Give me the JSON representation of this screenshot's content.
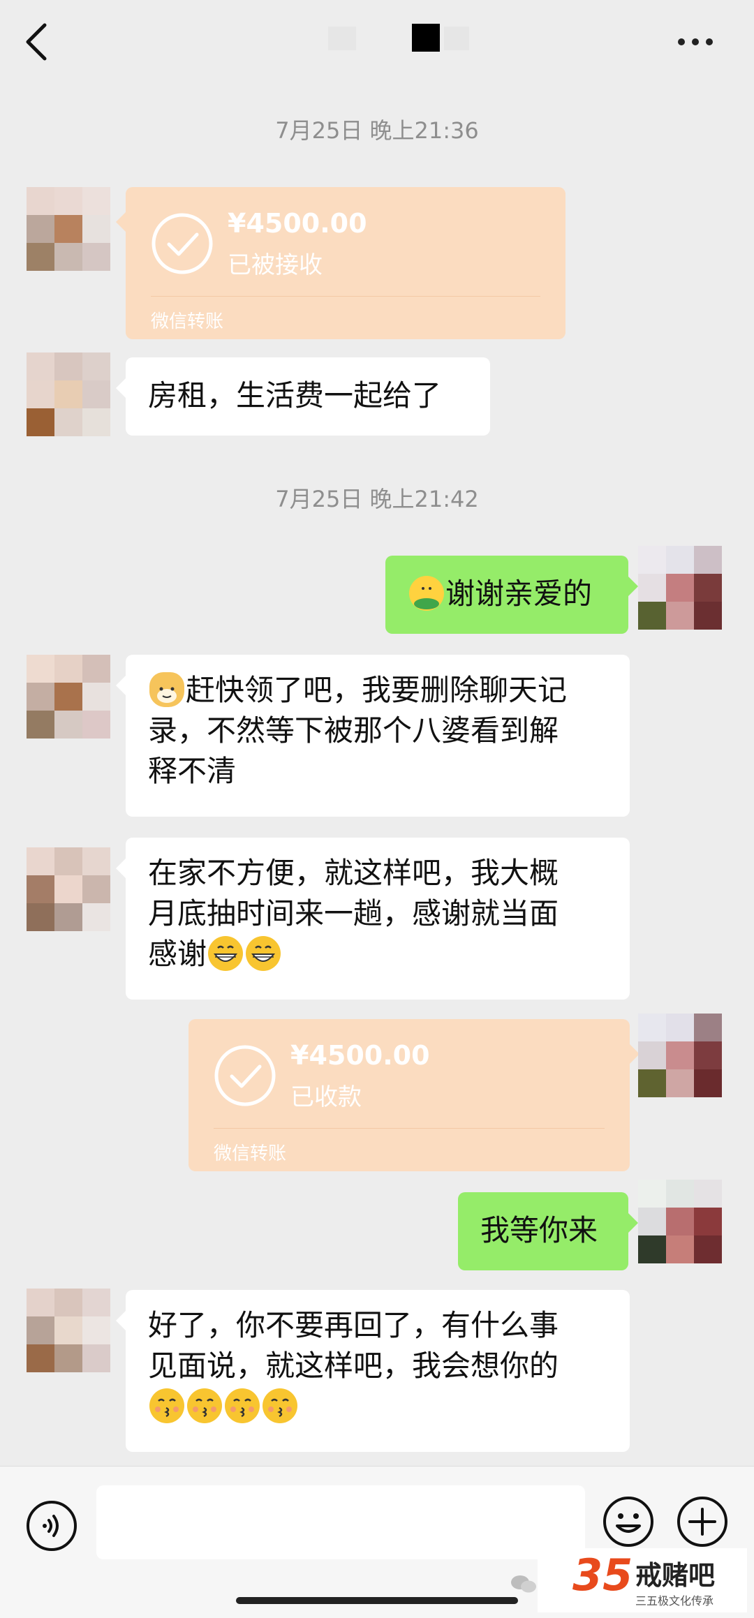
{
  "header": {
    "back_icon": "chevron-left-icon",
    "more_icon": "more-dots-icon"
  },
  "messages": [
    {
      "type": "timestamp",
      "text": "7月25日 晚上21:36"
    },
    {
      "type": "transfer",
      "side": "left",
      "amount": "¥4500.00",
      "status": "已被接收",
      "footer": "微信转账"
    },
    {
      "type": "text",
      "side": "left",
      "text": "房租，生活费一起给了"
    },
    {
      "type": "timestamp",
      "text": "7月25日 晚上21:42"
    },
    {
      "type": "text",
      "side": "right",
      "text": "谢谢亲爱的",
      "emoji_before": "hugging-emoji"
    },
    {
      "type": "text",
      "side": "left",
      "line1": "赶快领了吧，我要删除聊天记",
      "line2": "录，不然等下被那个八婆看到解",
      "line3": "释不清",
      "emoji_before": "cat-face-emoji"
    },
    {
      "type": "text",
      "side": "left",
      "line1": "在家不方便，就这样吧，我大概",
      "line2": "月底抽时间来一趟，感谢就当面",
      "line3": "感谢",
      "emoji_after": [
        "grinning-emoji",
        "grinning-emoji"
      ]
    },
    {
      "type": "transfer",
      "side": "right",
      "amount": "¥4500.00",
      "status": "已收款",
      "footer": "微信转账"
    },
    {
      "type": "text",
      "side": "right",
      "text": "我等你来"
    },
    {
      "type": "text",
      "side": "left",
      "line1": "好了，你不要再回了，有什么事",
      "line2": "见面说，就这样吧，我会想你的",
      "emoji_after": [
        "kissing-emoji",
        "kissing-emoji",
        "kissing-emoji",
        "kissing-emoji"
      ]
    }
  ],
  "input_bar": {
    "voice_icon": "voice-icon",
    "emoji_icon": "emoji-icon",
    "plus_icon": "plus-icon"
  },
  "watermark": {
    "number": "35",
    "name": "戒赌吧",
    "subtitle": "三五极文化传承"
  },
  "colors": {
    "background": "#ededed",
    "self_bubble": "#95ec69",
    "other_bubble": "#ffffff",
    "transfer_bubble": "#fbdcc0"
  }
}
